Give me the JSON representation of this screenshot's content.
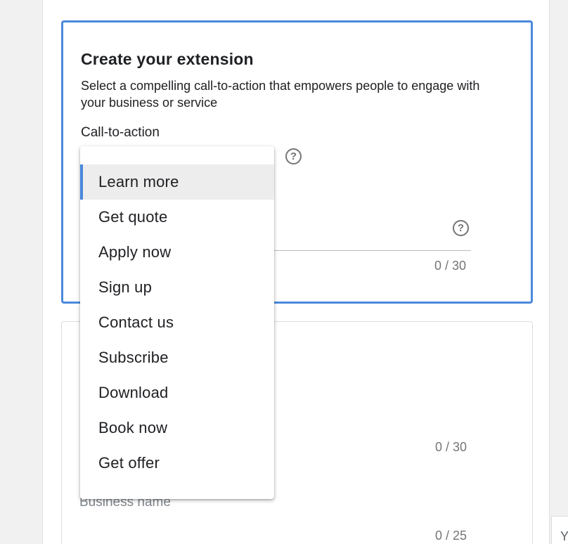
{
  "extension_card": {
    "title": "Create your extension",
    "description": "Select a compelling call-to-action that empowers people to engage with your business or service",
    "cta_label": "Call-to-action",
    "help_glyph": "?",
    "text_counter": "0 / 30"
  },
  "second_card": {
    "counter_1": "0 / 30",
    "business_name_label": "Business name",
    "counter_2": "0 / 25"
  },
  "right_field": {
    "text": "Y"
  },
  "dropdown": {
    "selected": "Learn more",
    "options": [
      "Learn more",
      "Get quote",
      "Apply now",
      "Sign up",
      "Contact us",
      "Subscribe",
      "Download",
      "Book now",
      "Get offer"
    ]
  },
  "colors": {
    "accent": "#4a89dc",
    "selected_bg": "#ededed",
    "page_bg": "#f1f1f1"
  }
}
